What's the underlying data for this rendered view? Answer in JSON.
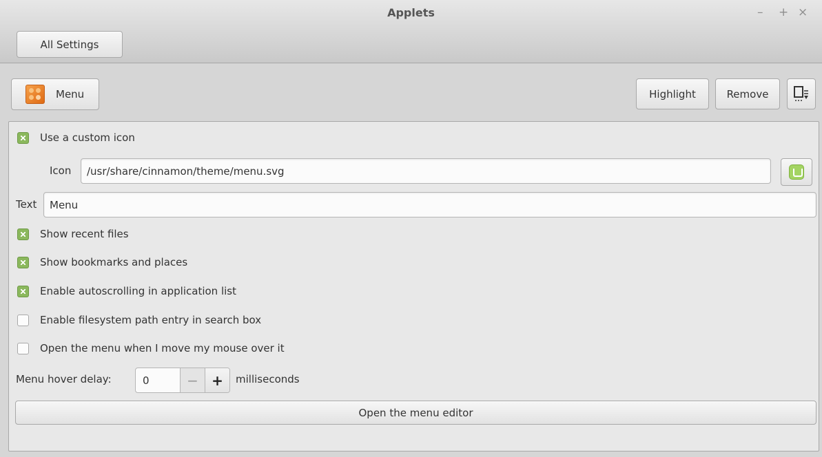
{
  "window": {
    "title": "Applets",
    "minimize": "–",
    "maximize": "+",
    "close": "×"
  },
  "header": {
    "all_settings_label": "All Settings"
  },
  "toolbar": {
    "applet_label": "Menu",
    "highlight_label": "Highlight",
    "remove_label": "Remove",
    "applet_icon": "menu-applet-icon",
    "export_icon": "export-icon"
  },
  "settings": {
    "custom_icon": {
      "label": "Use a custom icon",
      "checked": true
    },
    "icon_field": {
      "label": "Icon",
      "value": "/usr/share/cinnamon/theme/menu.svg",
      "chooser_icon": "linux-mint-icon"
    },
    "text_field": {
      "label": "Text",
      "value": "Menu"
    },
    "recent_files": {
      "label": "Show recent files",
      "checked": true
    },
    "bookmarks": {
      "label": "Show bookmarks and places",
      "checked": true
    },
    "autoscroll": {
      "label": "Enable autoscrolling in application list",
      "checked": true
    },
    "fs_path": {
      "label": "Enable filesystem path entry in search box",
      "checked": false
    },
    "hover_open": {
      "label": "Open the menu when I move my mouse over it",
      "checked": false
    },
    "hover_delay": {
      "label": "Menu hover delay:",
      "value": "0",
      "minus": "−",
      "plus": "+",
      "unit": "milliseconds"
    },
    "menu_editor_label": "Open the menu editor"
  },
  "colors": {
    "check_accent": "#8bb85d",
    "menu_icon_orange": "#de6a14"
  }
}
